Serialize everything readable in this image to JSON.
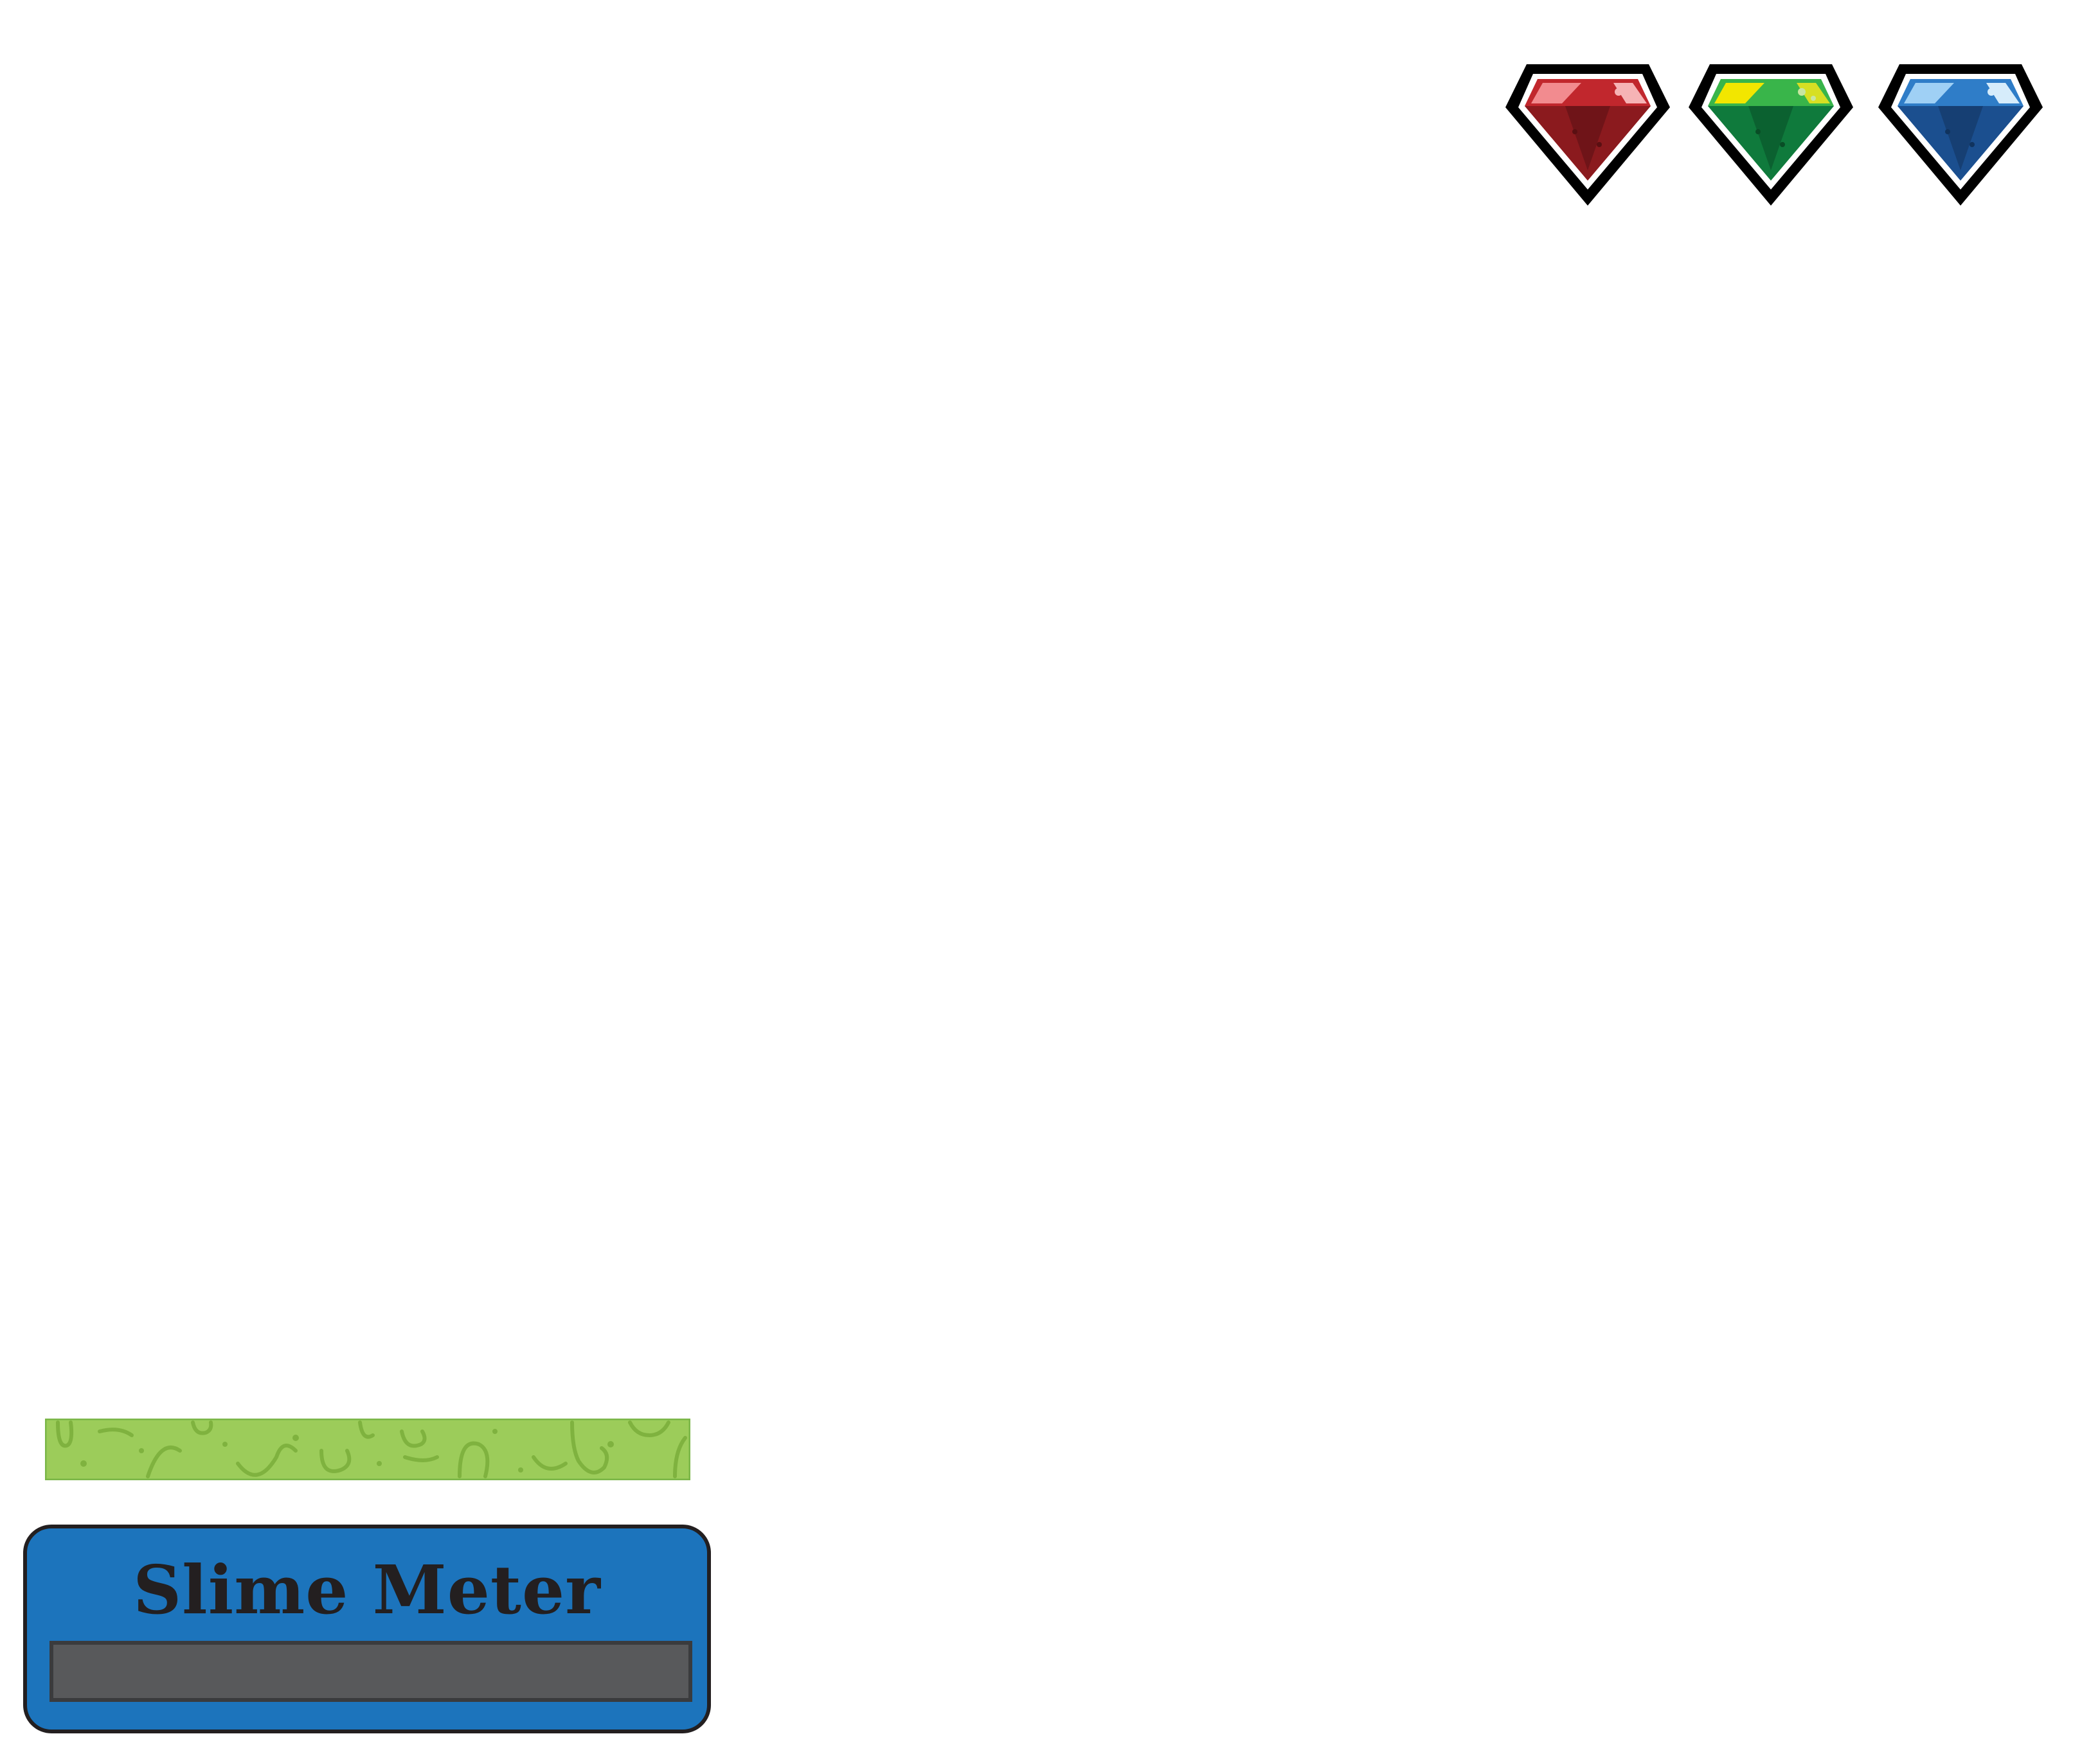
{
  "gems": [
    {
      "name": "red-gem",
      "color": "#c1272d",
      "dark": "#8b1a1e",
      "light": "#f28b8f"
    },
    {
      "name": "green-gem",
      "color": "#39b54a",
      "dark": "#0f7a3c",
      "light": "#f2e600"
    },
    {
      "name": "blue-gem",
      "color": "#2f7dc8",
      "dark": "#1b4f8f",
      "light": "#9fd0f5"
    }
  ],
  "slime": {
    "color": "#9ccc5a",
    "edge": "#7ab648"
  },
  "meter": {
    "title": "Slime Meter",
    "level": 0,
    "panel_color": "#1c74bc",
    "track_color": "#58595b"
  }
}
